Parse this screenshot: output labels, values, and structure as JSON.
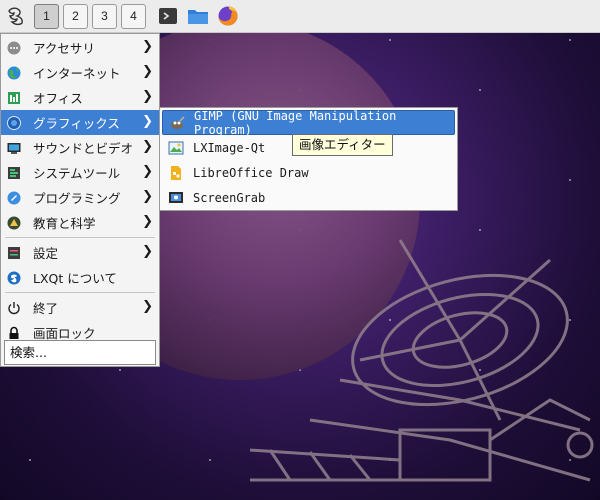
{
  "panel": {
    "desktops": [
      "1",
      "2",
      "3",
      "4"
    ],
    "active_desktop": "1",
    "quick_launch": [
      {
        "icon": "terminal-icon",
        "color": "#3a3a3a"
      },
      {
        "icon": "folder-icon",
        "color": "#2f7fd8"
      },
      {
        "icon": "firefox-icon",
        "color": "#e8531a"
      }
    ]
  },
  "main_menu": {
    "items": [
      {
        "label": "アクセサリ",
        "icon": "accessories-icon",
        "submenu": true
      },
      {
        "label": "インターネット",
        "icon": "internet-icon",
        "submenu": true
      },
      {
        "label": "オフィス",
        "icon": "office-icon",
        "submenu": true
      },
      {
        "label": "グラフィックス",
        "icon": "graphics-icon",
        "submenu": true,
        "selected": true
      },
      {
        "label": "サウンドとビデオ",
        "icon": "sound-video-icon",
        "submenu": true
      },
      {
        "label": "システムツール",
        "icon": "system-tools-icon",
        "submenu": true
      },
      {
        "label": "プログラミング",
        "icon": "programming-icon",
        "submenu": true
      },
      {
        "label": "教育と科学",
        "icon": "education-icon",
        "submenu": true
      }
    ],
    "settings": {
      "label": "設定",
      "icon": "settings-icon"
    },
    "about": {
      "label": "LXQt について",
      "icon": "lxqt-about-icon"
    },
    "leave": {
      "label": "終了",
      "icon": "power-icon"
    },
    "lock": {
      "label": "画面ロック",
      "icon": "lock-icon"
    },
    "search_placeholder": "検索..."
  },
  "graphics_submenu": {
    "items": [
      {
        "label": "GIMP (GNU Image Manipulation Program)",
        "icon": "gimp-icon",
        "selected": true
      },
      {
        "label": "LXImage-Qt",
        "icon": "lximage-icon"
      },
      {
        "label": "LibreOffice Draw",
        "icon": "libreoffice-draw-icon"
      },
      {
        "label": "ScreenGrab",
        "icon": "screengrab-icon"
      }
    ]
  },
  "tooltip": {
    "text": "画像エディター"
  },
  "colors": {
    "selection": "#3d7fd3",
    "panel": "#ececec",
    "menu_bg": "#f4f4f4",
    "tooltip_bg": "#ffffdc"
  }
}
